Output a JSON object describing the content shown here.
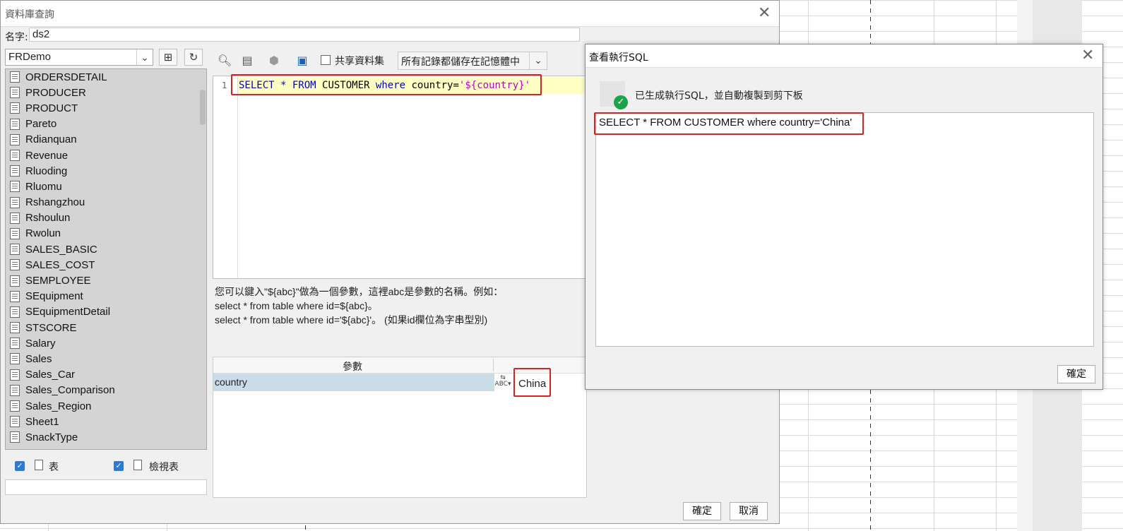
{
  "main_dialog": {
    "title": "資料庫查詢",
    "name_label": "名字:",
    "name_value": "ds2",
    "connection": "FRDemo",
    "tables": [
      "ORDERSDETAIL",
      "PRODUCER",
      "PRODUCT",
      "Pareto",
      "Rdianquan",
      "Revenue",
      "Rluoding",
      "Rluomu",
      "Rshangzhou",
      "Rshoulun",
      "Rwolun",
      "SALES_BASIC",
      "SALES_COST",
      "SEMPLOYEE",
      "SEquipment",
      "SEquipmentDetail",
      "STSCORE",
      "Salary",
      "Sales",
      "Sales_Car",
      "Sales_Comparison",
      "Sales_Region",
      "Sheet1",
      "SnackType"
    ],
    "filter_table": "表",
    "filter_view": "檢視表",
    "share_dataset": "共享資料集",
    "memory_option": "所有記錄都儲存在記憶體中",
    "sql": {
      "line_number": "1",
      "kw_select": "SELECT",
      "star": " * ",
      "kw_from": "FROM",
      "table": " CUSTOMER ",
      "kw_where": "where",
      "cond": " country=",
      "param_str": "'${country}'"
    },
    "help_lines": [
      "您可以鍵入\"${abc}\"做為一個參數，這裡abc是參數的名稱。例如：",
      "select * from table where id=${abc}。",
      "select * from table where id='${abc}'。 (如果id欄位為字串型別)"
    ],
    "param_header": "參數",
    "param_name": "country",
    "param_value": "China",
    "ok_label": "確定",
    "cancel_label": "取消"
  },
  "sql_dialog": {
    "title": "查看執行SQL",
    "message": "已生成執行SQL，並自動複製到剪下板",
    "result_sql": "SELECT * FROM CUSTOMER where country='China'",
    "ok_label": "確定"
  },
  "colors": {
    "highlight_box": "#e02020",
    "keyword": "#0000d0",
    "string": "#c000c0",
    "param_row": "#c9dce8"
  }
}
